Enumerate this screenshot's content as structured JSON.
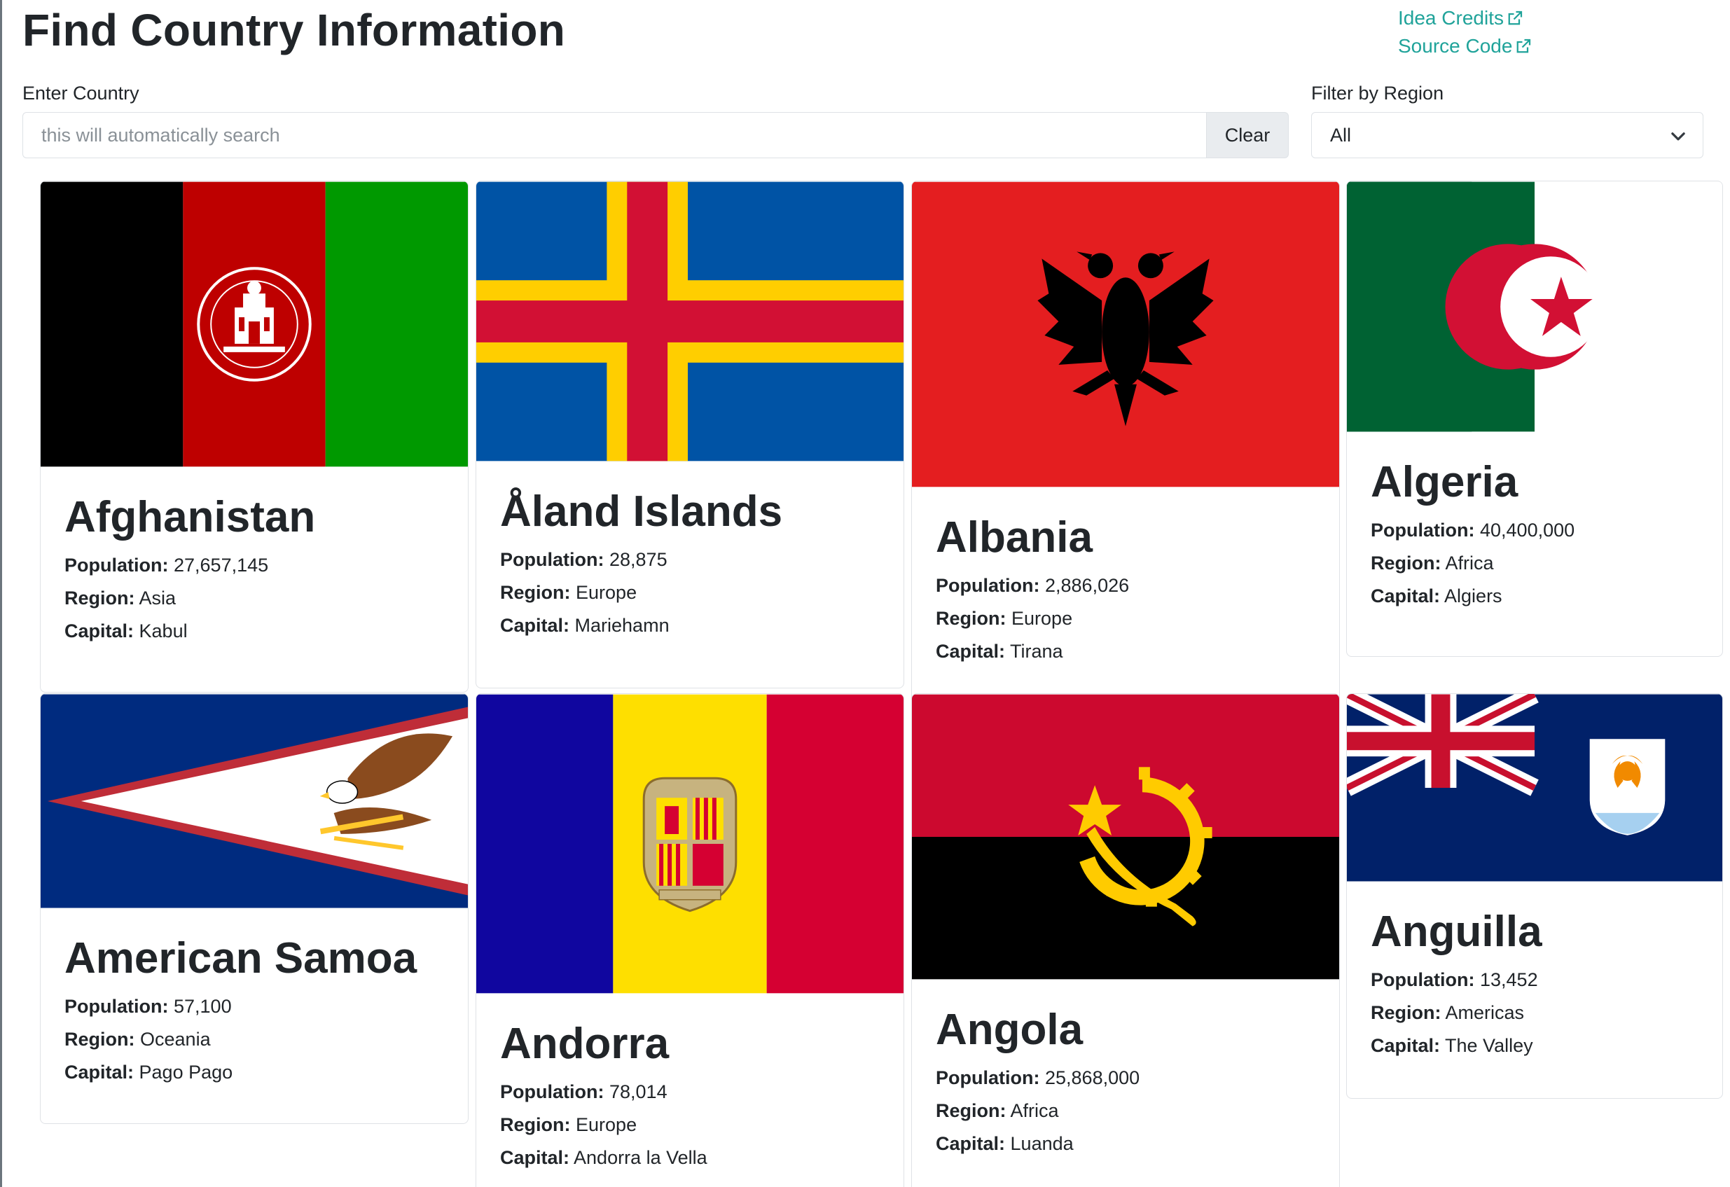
{
  "header": {
    "title": "Find Country Information",
    "idea_credits": "Idea Credits",
    "source_code": "Source Code"
  },
  "search": {
    "label": "Enter Country",
    "placeholder": "this will automatically search",
    "value": "",
    "clear_label": "Clear"
  },
  "filter": {
    "label": "Filter by Region",
    "selected": "All"
  },
  "labels": {
    "population": "Population:",
    "region": "Region:",
    "capital": "Capital:"
  },
  "countries": [
    {
      "name": "Afghanistan",
      "population": "27,657,145",
      "region": "Asia",
      "capital": "Kabul",
      "flag": "afghanistan-flag"
    },
    {
      "name": "Åland Islands",
      "population": "28,875",
      "region": "Europe",
      "capital": "Mariehamn",
      "flag": "aland-islands-flag"
    },
    {
      "name": "Albania",
      "population": "2,886,026",
      "region": "Europe",
      "capital": "Tirana",
      "flag": "albania-flag"
    },
    {
      "name": "Algeria",
      "population": "40,400,000",
      "region": "Africa",
      "capital": "Algiers",
      "flag": "algeria-flag"
    },
    {
      "name": "American Samoa",
      "population": "57,100",
      "region": "Oceania",
      "capital": "Pago Pago",
      "flag": "american-samoa-flag"
    },
    {
      "name": "Andorra",
      "population": "78,014",
      "region": "Europe",
      "capital": "Andorra la Vella",
      "flag": "andorra-flag"
    },
    {
      "name": "Angola",
      "population": "25,868,000",
      "region": "Africa",
      "capital": "Luanda",
      "flag": "angola-flag"
    },
    {
      "name": "Anguilla",
      "population": "13,452",
      "region": "Americas",
      "capital": "The Valley",
      "flag": "anguilla-flag"
    }
  ],
  "colors": {
    "link": "#20a39a",
    "text": "#212529",
    "border": "#dee2e6",
    "button_bg": "#e9ecef"
  }
}
